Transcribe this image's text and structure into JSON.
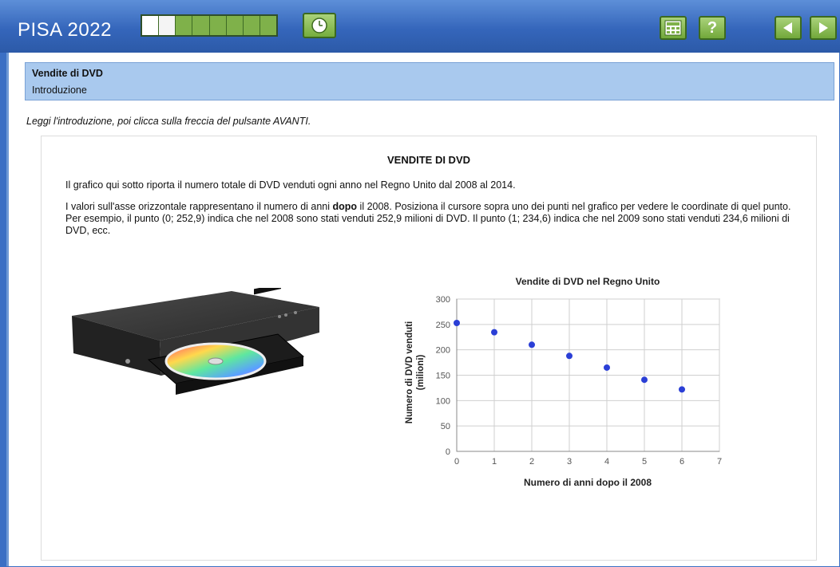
{
  "app": {
    "title": "PISA 2022",
    "progress": {
      "total_segments": 8,
      "current_segment": 2
    },
    "colors": {
      "bar": "#3566bb",
      "button_green": "#7fb14a",
      "header_blue": "#a9c9ee"
    }
  },
  "toolbar": {
    "timer_icon": "clock-icon",
    "calculator_icon": "calculator-icon",
    "help_label": "?",
    "back_icon": "arrow-left-icon",
    "next_icon": "arrow-right-icon"
  },
  "unit": {
    "title": "Vendite di DVD",
    "subtitle": "Introduzione"
  },
  "instruction": "Leggi l'introduzione, poi clicca sulla freccia del pulsante AVANTI.",
  "stimulus": {
    "title": "VENDITE DI DVD",
    "p1": "Il grafico qui sotto riporta il numero totale di DVD venduti ogni anno nel Regno Unito dal 2008 al 2014.",
    "p2_before": "I valori sull'asse orizzontale rappresentano il numero di anni ",
    "p2_bold": "dopo",
    "p2_after": " il 2008. Posiziona il cursore sopra uno dei punti nel grafico per vedere le coordinate di quel punto. Per esempio, il punto (0; 252,9) indica che nel 2008 sono stati venduti 252,9 milioni di DVD. Il punto (1; 234,6) indica che nel 2009 sono stati venduti 234,6 milioni di DVD, ecc."
  },
  "chart_data": {
    "type": "scatter",
    "title": "Vendite di DVD nel Regno Unito",
    "xlabel": "Numero di anni dopo il 2008",
    "ylabel_line1": "Numero di DVD venduti",
    "ylabel_line2": "(milioni)",
    "xlim": [
      0,
      7
    ],
    "ylim": [
      0,
      300
    ],
    "xticks": [
      0,
      1,
      2,
      3,
      4,
      5,
      6,
      7
    ],
    "yticks": [
      0,
      50,
      100,
      150,
      200,
      250,
      300
    ],
    "grid": true,
    "point_color": "#2b3fd6",
    "x": [
      0,
      1,
      2,
      3,
      4,
      5,
      6
    ],
    "y": [
      252.9,
      234.6,
      210,
      188,
      165,
      141,
      122
    ]
  }
}
